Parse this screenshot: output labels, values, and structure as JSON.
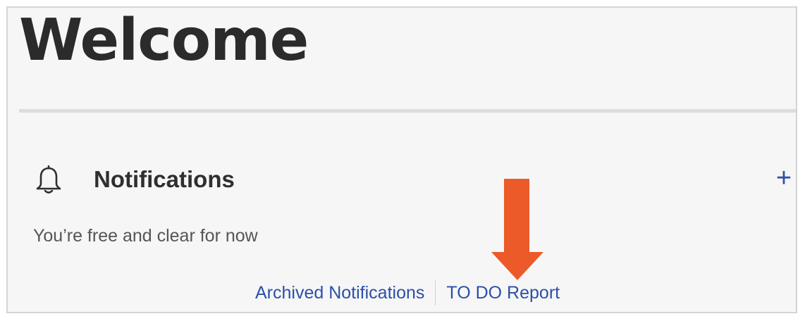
{
  "header": {
    "title": "Welcome"
  },
  "notifications": {
    "heading": "Notifications",
    "icon": "bell-icon",
    "add_label": "+",
    "empty_message": "You’re free and clear for now"
  },
  "links": {
    "archived": "Archived Notifications",
    "todo_report": "TO DO Report"
  },
  "colors": {
    "link": "#2c4fa8",
    "annotation_arrow": "#ec5a29"
  }
}
